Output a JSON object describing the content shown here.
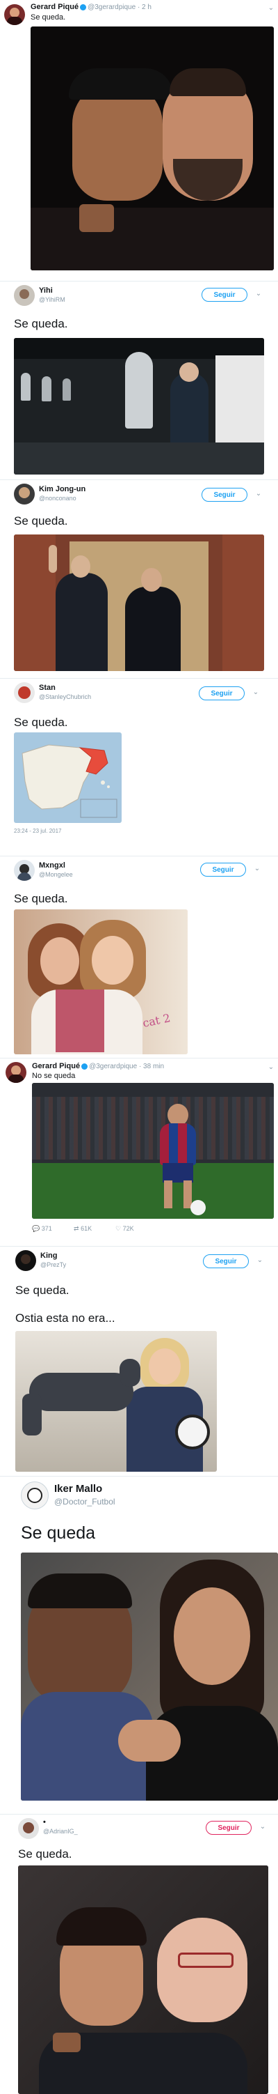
{
  "tweets": {
    "t1": {
      "name": "Gerard Piqué",
      "handle": "@3gerardpique · 2 h",
      "text": "Se queda."
    },
    "t2": {
      "name": "Yihi",
      "handle": "@YihiRM",
      "text": "Se queda.",
      "follow": "Seguir"
    },
    "t3": {
      "name": "Kim Jong-un",
      "handle": "@nonconano",
      "text": "Se queda.",
      "follow": "Seguir"
    },
    "t4": {
      "name": "Stan",
      "handle": "@StanleyChubrich",
      "text": "Se queda.",
      "follow": "Seguir",
      "timestamp": "23:24 - 23 jul. 2017"
    },
    "t5": {
      "name": "Mxngxl",
      "handle": "@Mongelee",
      "text": "Se queda.",
      "follow": "Seguir",
      "photo_writing": "cat 2"
    },
    "t6": {
      "name": "Gerard Piqué",
      "handle": "@3gerardpique · 38 min",
      "text": "No se queda",
      "replies": "371",
      "retweets": "61K",
      "likes": "72K"
    },
    "t7": {
      "name": "King",
      "handle": "@PrezTy",
      "text": "Se queda.",
      "text2": "Ostia esta no era...",
      "follow": "Seguir"
    },
    "t8": {
      "name": "Iker Mallo",
      "handle": "@Doctor_Futbol",
      "text": "Se queda"
    },
    "t9": {
      "name": "•",
      "handle": "@AdrianIG_",
      "text": "Se queda.",
      "follow": "Seguir"
    }
  },
  "colors": {
    "twitter_blue": "#1da1f2",
    "follow_red": "#e0245e",
    "meta_gray": "#8899a6"
  }
}
